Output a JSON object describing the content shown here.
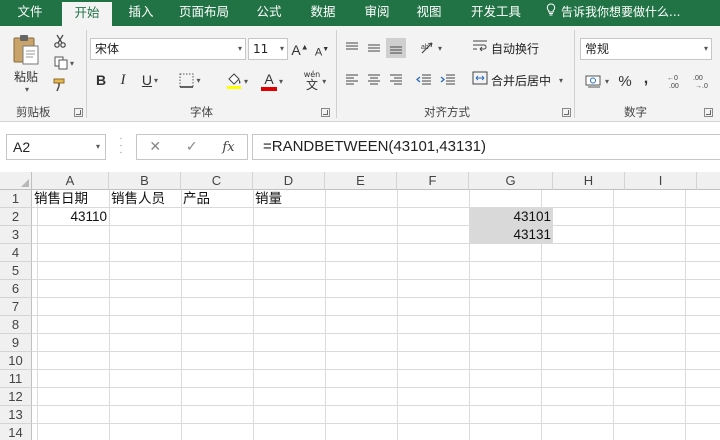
{
  "tabs": [
    {
      "label": "文件",
      "active": false
    },
    {
      "label": "开始",
      "active": true
    },
    {
      "label": "插入",
      "active": false
    },
    {
      "label": "页面布局",
      "active": false
    },
    {
      "label": "公式",
      "active": false
    },
    {
      "label": "数据",
      "active": false
    },
    {
      "label": "审阅",
      "active": false
    },
    {
      "label": "视图",
      "active": false
    },
    {
      "label": "开发工具",
      "active": false
    }
  ],
  "tell_me": "告诉我你想要做什么...",
  "ribbon": {
    "clipboard": {
      "paste_label": "粘贴",
      "group_label": "剪贴板"
    },
    "font": {
      "font_name": "宋体",
      "font_size": "11",
      "bold": "B",
      "italic": "I",
      "underline": "U",
      "font_color_glyph": "A",
      "phonetic_glyph": "wén",
      "group_label": "字体"
    },
    "alignment": {
      "wrap_text": "自动换行",
      "merge_center": "合并后居中",
      "group_label": "对齐方式"
    },
    "number": {
      "format": "常规",
      "percent": "%",
      "comma": ",",
      "group_label": "数字"
    }
  },
  "formula_bar": {
    "name_box": "A2",
    "cancel_glyph": "✕",
    "enter_glyph": "✓",
    "fx_glyph": "fx",
    "formula": "=RANDBETWEEN(43101,43131)"
  },
  "grid": {
    "columns": [
      "A",
      "B",
      "C",
      "D",
      "E",
      "F",
      "G",
      "H",
      "I"
    ],
    "rows": [
      "1",
      "2",
      "3",
      "4",
      "5",
      "6",
      "7",
      "8",
      "9",
      "10",
      "11",
      "12",
      "13",
      "14"
    ],
    "cells": {
      "A1": "销售日期",
      "B1": "销售人员",
      "C1": "产品",
      "D1": "销量",
      "A2": "43110",
      "G2": "43101",
      "G3": "43131"
    }
  },
  "colors": {
    "accent": "#217346",
    "ribbon_bg": "#f3f3f3",
    "selection_gray": "#d9d9d9"
  }
}
